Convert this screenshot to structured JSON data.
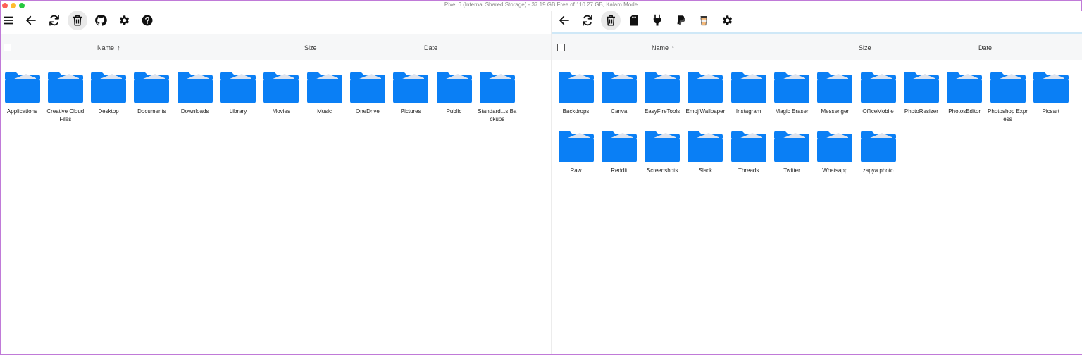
{
  "window": {
    "title": "Pixel 6 (Internal Shared Storage) - 37.19 GB Free of 110.27 GB, Kalam Mode"
  },
  "colors": {
    "folder": "#0a7ff5",
    "folder_paper": "#dde3ee",
    "active_line": "#cfe8f7"
  },
  "left_pane": {
    "toolbar": [
      {
        "icon": "hamburger-icon"
      },
      {
        "icon": "back-arrow-icon"
      },
      {
        "icon": "refresh-icon"
      },
      {
        "icon": "trash-icon"
      },
      {
        "icon": "github-icon"
      },
      {
        "icon": "gear-icon"
      },
      {
        "icon": "help-icon"
      }
    ],
    "columns": {
      "name": "Name",
      "size": "Size",
      "date": "Date",
      "sort": "ascending"
    },
    "folders": [
      "Applications",
      "Creative Cloud Files",
      "Desktop",
      "Documents",
      "Downloads",
      "Library",
      "Movies",
      "Music",
      "OneDrive",
      "Pictures",
      "Public",
      "Standard...s Backups"
    ]
  },
  "right_pane": {
    "toolbar": [
      {
        "icon": "back-arrow-icon"
      },
      {
        "icon": "refresh-icon"
      },
      {
        "icon": "trash-icon"
      },
      {
        "icon": "sd-card-icon"
      },
      {
        "icon": "plug-icon"
      },
      {
        "icon": "paypal-icon"
      },
      {
        "icon": "coffee-cup-icon"
      },
      {
        "icon": "gear-icon"
      }
    ],
    "columns": {
      "name": "Name",
      "size": "Size",
      "date": "Date",
      "sort": "ascending"
    },
    "folders": [
      "Backdrops",
      "Canva",
      "EasyFireTools",
      "EmojiWallpaper",
      "Instagram",
      "Magic Eraser",
      "Messenger",
      "OfficeMobile",
      "PhotoResizer",
      "PhotosEditor",
      "Photoshop Express",
      "Picsart",
      "Raw",
      "Reddit",
      "Screenshots",
      "Slack",
      "Threads",
      "Twitter",
      "Whatsapp",
      "zapya.photo"
    ]
  }
}
